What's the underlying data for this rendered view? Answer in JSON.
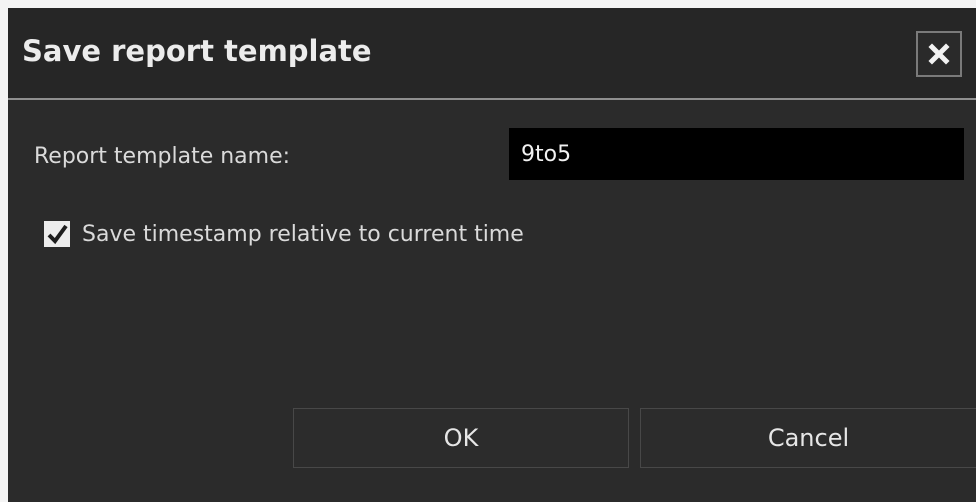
{
  "dialog": {
    "title": "Save report template",
    "close_icon": "close-icon"
  },
  "form": {
    "name_label": "Report template name:",
    "name_value": "9to5",
    "timestamp_checkbox": {
      "label": "Save timestamp relative to current time",
      "checked": true
    }
  },
  "buttons": {
    "ok_label": "OK",
    "cancel_label": "Cancel"
  },
  "colors": {
    "dialog_background": "#2b2b2b",
    "titlebar_background": "#262626",
    "input_background": "#000000",
    "text": "#e6e6e6"
  }
}
